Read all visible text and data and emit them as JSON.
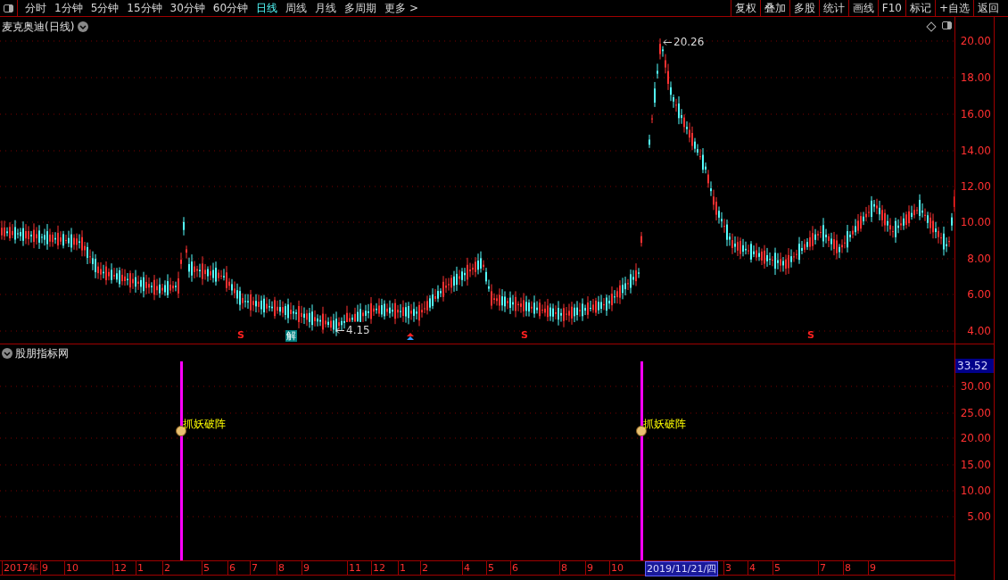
{
  "toolbar": {
    "periods": [
      {
        "label": "分时",
        "selected": false
      },
      {
        "label": "1分钟",
        "selected": false
      },
      {
        "label": "5分钟",
        "selected": false
      },
      {
        "label": "15分钟",
        "selected": false
      },
      {
        "label": "30分钟",
        "selected": false
      },
      {
        "label": "60分钟",
        "selected": false
      },
      {
        "label": "日线",
        "selected": true
      },
      {
        "label": "周线",
        "selected": false
      },
      {
        "label": "月线",
        "selected": false
      },
      {
        "label": "多周期",
        "selected": false
      },
      {
        "label": "更多 >",
        "selected": false
      }
    ],
    "buttons": [
      "复权",
      "叠加",
      "多股",
      "统计",
      "画线",
      "F10",
      "标记",
      "+自选",
      "返回"
    ]
  },
  "main_chart": {
    "title": "麦克奥迪(日线)",
    "high_label": "20.26",
    "low_label": "4.15",
    "y_ticks": [
      "20.00",
      "18.00",
      "16.00",
      "14.00",
      "12.00",
      "10.00",
      "8.00",
      "6.00",
      "4.00"
    ],
    "signals": [
      {
        "kind": "s",
        "text": "S"
      },
      {
        "kind": "badge",
        "text": "解"
      },
      {
        "kind": "arrow"
      },
      {
        "kind": "s",
        "text": "S"
      },
      {
        "kind": "s",
        "text": "S"
      }
    ]
  },
  "indicator": {
    "title": "股朋指标网",
    "current": "33.52",
    "y_ticks": [
      "30.00",
      "25.00",
      "20.00",
      "15.00",
      "10.00",
      "5.00"
    ],
    "signals": [
      {
        "label": "抓妖破阵"
      },
      {
        "label": "抓妖破阵"
      }
    ]
  },
  "date_axis": [
    {
      "text": "2017年",
      "selected": false
    },
    {
      "text": "9",
      "selected": false
    },
    {
      "text": "10",
      "selected": false
    },
    {
      "text": "12",
      "selected": false
    },
    {
      "text": "1",
      "selected": false
    },
    {
      "text": "2",
      "selected": false
    },
    {
      "text": "5",
      "selected": false
    },
    {
      "text": "6",
      "selected": false
    },
    {
      "text": "7",
      "selected": false
    },
    {
      "text": "8",
      "selected": false
    },
    {
      "text": "9",
      "selected": false
    },
    {
      "text": "11",
      "selected": false
    },
    {
      "text": "12",
      "selected": false
    },
    {
      "text": "1",
      "selected": false
    },
    {
      "text": "2",
      "selected": false
    },
    {
      "text": "4",
      "selected": false
    },
    {
      "text": "5",
      "selected": false
    },
    {
      "text": "6",
      "selected": false
    },
    {
      "text": "8",
      "selected": false
    },
    {
      "text": "9",
      "selected": false
    },
    {
      "text": "10",
      "selected": false
    },
    {
      "text": "2019/11/21/四",
      "selected": true
    },
    {
      "text": "3",
      "selected": false
    },
    {
      "text": "4",
      "selected": false
    },
    {
      "text": "5",
      "selected": false
    },
    {
      "text": "7",
      "selected": false
    },
    {
      "text": "8",
      "selected": false
    },
    {
      "text": "9",
      "selected": false
    }
  ]
}
